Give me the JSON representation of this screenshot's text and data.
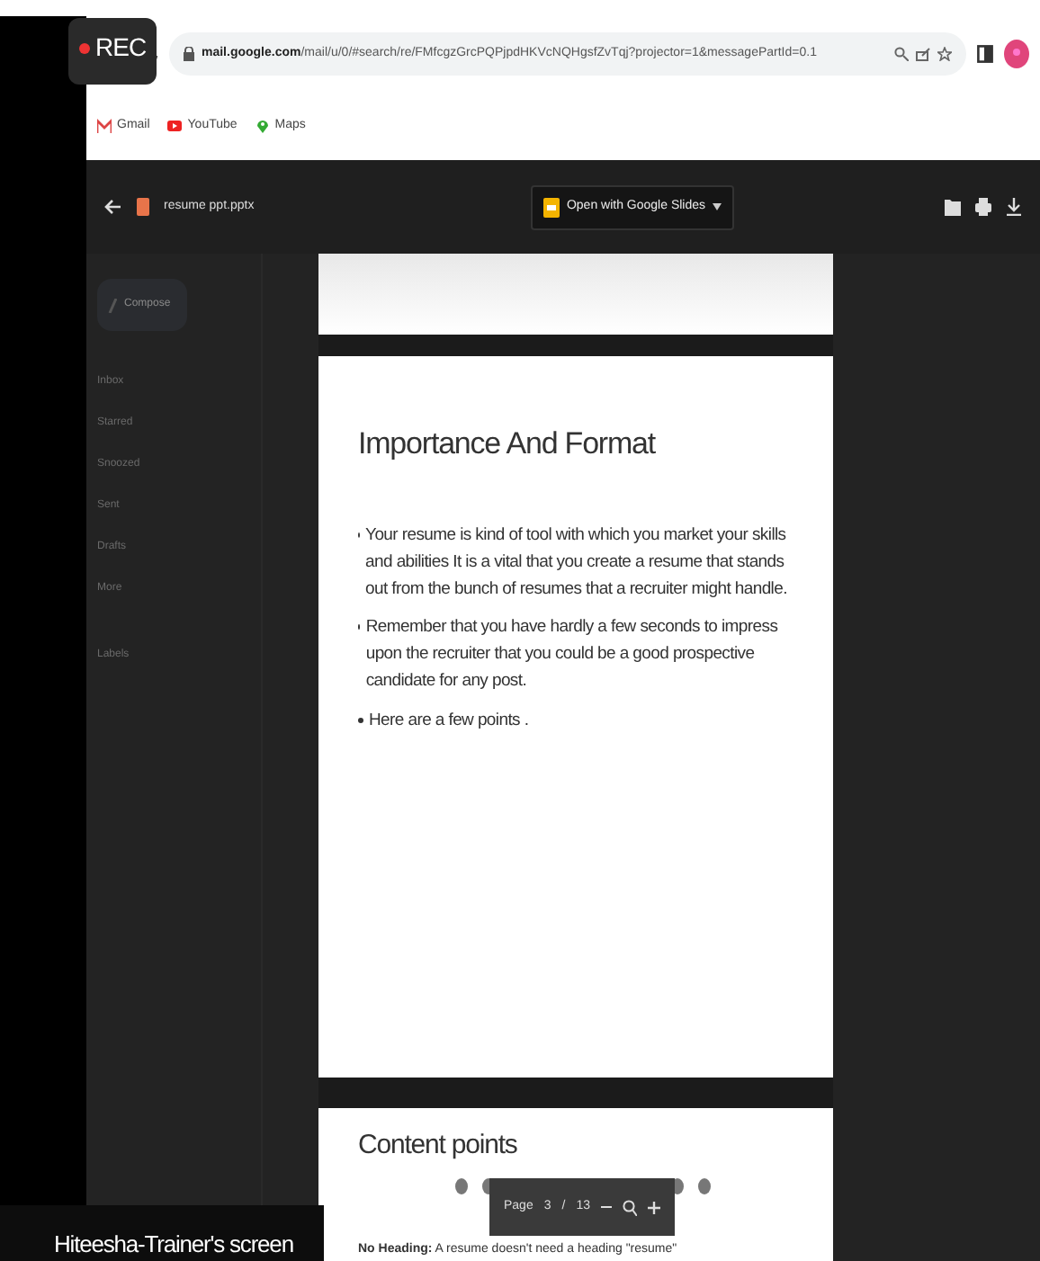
{
  "recording": {
    "label": "REC"
  },
  "browser": {
    "url": "mail.google.com/mail/u/0/#search/re/FMfcgzGrcPQPjpdHKVcNQHgsfZvTqj?projector=1&messagePartId=0.1",
    "bookmarks": [
      {
        "label": "Gmail",
        "kind": "gmail"
      },
      {
        "label": "YouTube",
        "kind": "youtube"
      },
      {
        "label": "Maps",
        "kind": "maps"
      }
    ]
  },
  "viewer": {
    "file_name": "resume ppt.pptx",
    "open_button": "Open with Google Slides"
  },
  "gmail_sidebar": {
    "compose": "Compose",
    "items": [
      "Inbox",
      "Starred",
      "Snoozed",
      "Sent",
      "Drafts",
      "More"
    ],
    "labels": "Labels"
  },
  "slides": [
    {
      "title": "Importance And Format",
      "bullets": [
        "Your resume is kind of tool with which you market your skills and abilities It is a vital that you create a resume that stands out from the bunch of resumes that a recruiter might handle.",
        "Remember that you have hardly a few seconds  to impress upon the recruiter that you could be a good prospective candidate for any post.",
        "Here are a few points ."
      ]
    },
    {
      "title": "Content points",
      "text": "**No Heading:** A resume doesn't need a heading \"resume\""
    }
  ],
  "page_toolbar": {
    "label": "Page",
    "current": "3",
    "separator": "/",
    "total": "13"
  },
  "presenter_caption": "Hiteesha-Trainer's screen"
}
